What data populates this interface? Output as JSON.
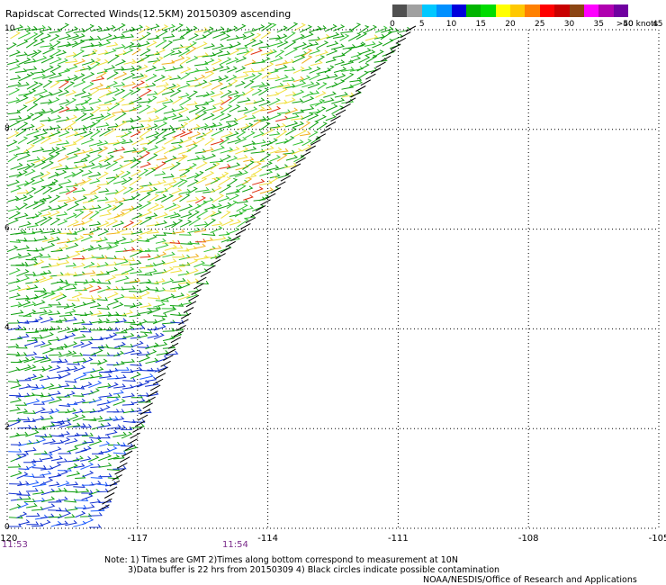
{
  "title": "Rapidscat Corrected Winds(12.5KM) 20150309 ascending",
  "legend": {
    "labels": [
      "0",
      "5",
      "10",
      "15",
      "20",
      "25",
      "30",
      "35",
      "40",
      "45",
      ">50 knots"
    ],
    "colors": [
      "#505050",
      "#a0a0a0",
      "#00c8ff",
      "#0090ff",
      "#0000dc",
      "#00b400",
      "#00dc00",
      "#ffff00",
      "#ffc800",
      "#ff8000",
      "#ff0000",
      "#c80000",
      "#8b4513",
      "#ff00ff",
      "#b000b0",
      "#7000a0"
    ]
  },
  "map": {
    "x_ticks": [
      "-120",
      "-117",
      "-114",
      "-111",
      "-108",
      "-105"
    ],
    "y_ticks": [
      "10",
      "8",
      "6",
      "4",
      "2",
      "0"
    ],
    "lon_range": [
      -120,
      -105
    ],
    "lat_range": [
      0,
      10
    ],
    "swath_edge": [
      [
        -110.7,
        10.0
      ],
      [
        -115.5,
        5.0
      ],
      [
        -117.8,
        0.3
      ]
    ]
  },
  "times": [
    {
      "text": "11:53",
      "lon": -120
    },
    {
      "text": "11:54",
      "lon": -114.8
    }
  ],
  "notes": {
    "line1": "Note: 1) Times are GMT 2)Times along bottom correspond to measurement at 10N",
    "line2": "3)Data buffer is 22 hrs from 20150309 4) Black circles indicate possible contamination",
    "credit": "NOAA/NESDIS/Office of Research and Applications"
  }
}
